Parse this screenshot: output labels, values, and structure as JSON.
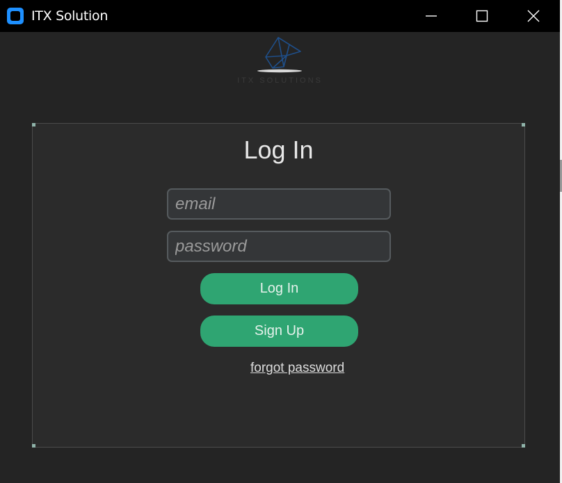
{
  "window": {
    "title": "ITX Solution",
    "controls": {
      "minimize": "minimize-icon",
      "maximize": "maximize-icon",
      "close": "close-icon"
    }
  },
  "logo": {
    "caption": "ITX SOLUTIONS"
  },
  "login": {
    "heading": "Log In",
    "email_placeholder": "email",
    "email_value": "",
    "password_placeholder": "password",
    "password_value": "",
    "login_label": "Log In",
    "signup_label": "Sign Up",
    "forgot_label": "forgot password"
  },
  "colors": {
    "accent": "#2fa572",
    "panel_bg": "#2b2b2b",
    "window_bg": "#242424",
    "titlebar_bg": "#000000",
    "app_icon": "#1e90ff"
  }
}
